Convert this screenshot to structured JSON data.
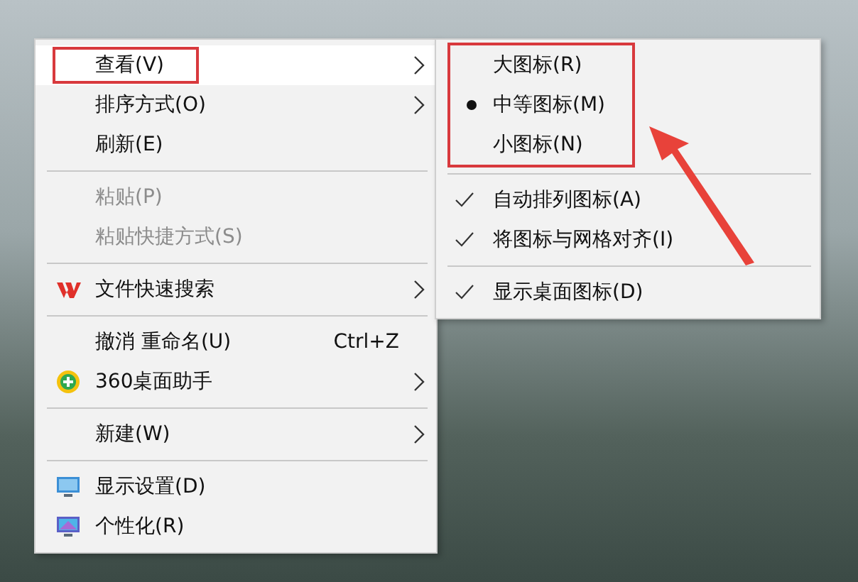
{
  "context_menu": {
    "groups": [
      [
        {
          "kind": "plain",
          "label": "查看(V)",
          "has_submenu": true,
          "disabled": false,
          "hovered": true,
          "annotated": true
        },
        {
          "kind": "plain",
          "label": "排序方式(O)",
          "has_submenu": true,
          "disabled": false,
          "hovered": false,
          "annotated": false
        },
        {
          "kind": "plain",
          "label": "刷新(E)",
          "has_submenu": false,
          "disabled": false,
          "hovered": false,
          "annotated": false
        }
      ],
      [
        {
          "kind": "plain",
          "label": "粘贴(P)",
          "has_submenu": false,
          "disabled": true,
          "hovered": false,
          "annotated": false
        },
        {
          "kind": "plain",
          "label": "粘贴快捷方式(S)",
          "has_submenu": false,
          "disabled": true,
          "hovered": false,
          "annotated": false
        }
      ],
      [
        {
          "kind": "w-logo",
          "label": "文件快速搜索",
          "has_submenu": true,
          "disabled": false,
          "hovered": false,
          "annotated": false
        }
      ],
      [
        {
          "kind": "plain",
          "label": "撤消 重命名(U)",
          "shortcut": "Ctrl+Z",
          "has_submenu": false,
          "disabled": false,
          "hovered": false,
          "annotated": false
        },
        {
          "kind": "plus-circle",
          "label": "360桌面助手",
          "has_submenu": true,
          "disabled": false,
          "hovered": false,
          "annotated": false
        }
      ],
      [
        {
          "kind": "plain",
          "label": "新建(W)",
          "has_submenu": true,
          "disabled": false,
          "hovered": false,
          "annotated": false
        }
      ],
      [
        {
          "kind": "monitor",
          "label": "显示设置(D)",
          "has_submenu": false,
          "disabled": false,
          "hovered": false,
          "annotated": false
        },
        {
          "kind": "monitor-art",
          "label": "个性化(R)",
          "has_submenu": false,
          "disabled": false,
          "hovered": false,
          "annotated": false
        }
      ]
    ]
  },
  "view_submenu": {
    "groups": [
      {
        "annotated": true,
        "items": [
          {
            "kind": "radio",
            "label": "大图标(R)",
            "selected": false
          },
          {
            "kind": "radio",
            "label": "中等图标(M)",
            "selected": true
          },
          {
            "kind": "radio",
            "label": "小图标(N)",
            "selected": false
          }
        ]
      },
      {
        "annotated": false,
        "items": [
          {
            "kind": "check",
            "label": "自动排列图标(A)",
            "checked": true
          },
          {
            "kind": "check",
            "label": "将图标与网格对齐(I)",
            "checked": true
          }
        ]
      },
      {
        "annotated": false,
        "items": [
          {
            "kind": "check",
            "label": "显示桌面图标(D)",
            "checked": true
          }
        ]
      }
    ]
  },
  "annotation_arrow": true
}
